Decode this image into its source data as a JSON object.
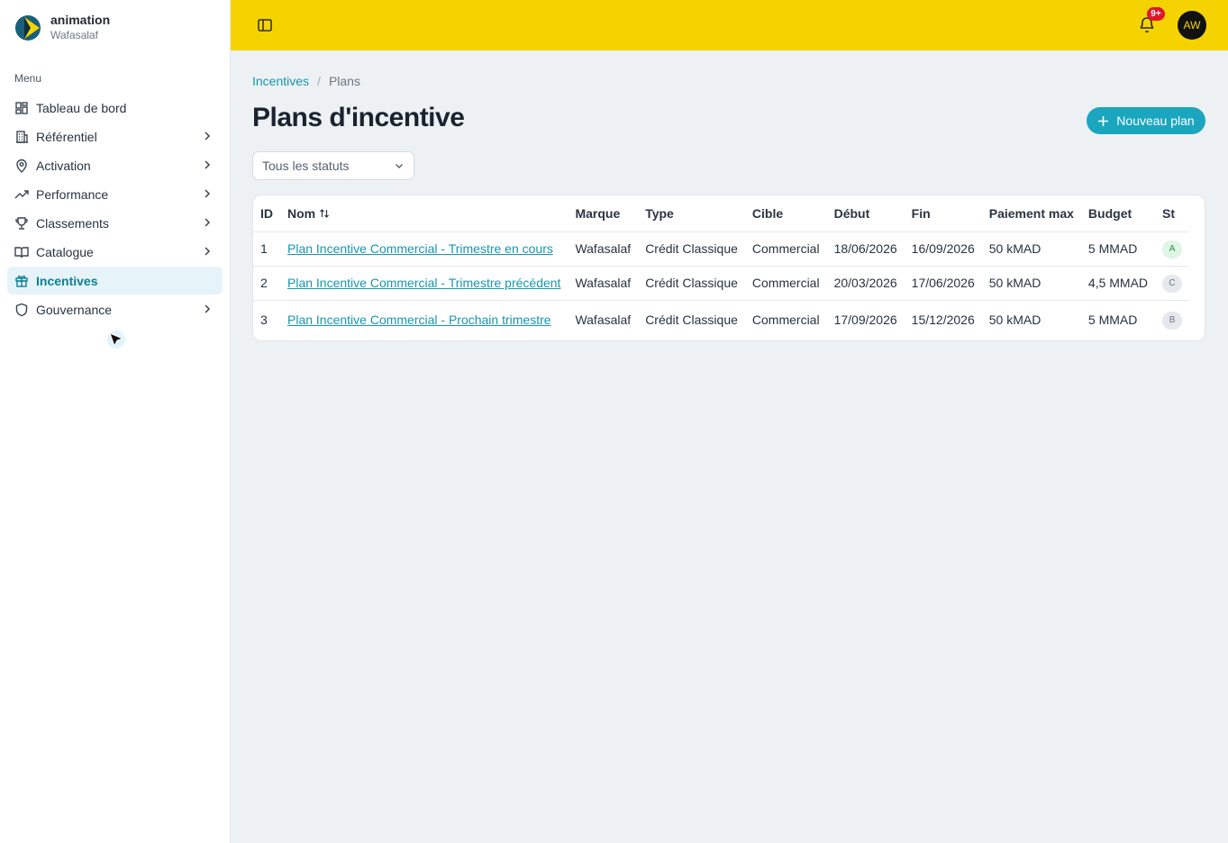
{
  "app": {
    "name": "animation",
    "org": "Wafasalaf"
  },
  "sidebar": {
    "heading": "Menu",
    "items": [
      {
        "label": "Tableau de bord",
        "icon": "dashboard-icon"
      },
      {
        "label": "Référentiel",
        "icon": "building-icon"
      },
      {
        "label": "Activation",
        "icon": "map-pin-icon"
      },
      {
        "label": "Performance",
        "icon": "trending-up-icon"
      },
      {
        "label": "Classements",
        "icon": "trophy-icon"
      },
      {
        "label": "Catalogue",
        "icon": "book-open-icon"
      },
      {
        "label": "Incentives",
        "icon": "gift-icon",
        "active": true
      },
      {
        "label": "Gouvernance",
        "icon": "shield-icon"
      }
    ]
  },
  "topbar": {
    "notifications_badge": "9+",
    "avatar_initials": "AW",
    "color": "#f5d300"
  },
  "breadcrumb": {
    "parent": "Incentives",
    "separator": "/",
    "current": "Plans"
  },
  "page": {
    "title": "Plans d'incentive",
    "new_button_label": "Nouveau plan"
  },
  "filter": {
    "status_value": "Tous les statuts"
  },
  "table": {
    "headers": [
      "ID",
      "Nom",
      "Marque",
      "Type",
      "Cible",
      "Début",
      "Fin",
      "Paiement max",
      "Budget",
      "St"
    ],
    "rows": [
      {
        "id": "1",
        "nom": "Plan Incentive Commercial - Trimestre en cours",
        "marque": "Wafasalaf",
        "type": "Crédit Classique",
        "cible": "Commercial",
        "debut": "18/06/2026",
        "fin": "16/09/2026",
        "paiement_max": "50 kMAD",
        "budget": "5 MMAD",
        "statut": "A"
      },
      {
        "id": "2",
        "nom": "Plan Incentive Commercial - Trimestre précédent",
        "marque": "Wafasalaf",
        "type": "Crédit Classique",
        "cible": "Commercial",
        "debut": "20/03/2026",
        "fin": "17/06/2026",
        "paiement_max": "50 kMAD",
        "budget": "4,5 MMAD",
        "statut": "C"
      },
      {
        "id": "3",
        "nom": "Plan Incentive Commercial - Prochain trimestre",
        "marque": "Wafasalaf",
        "type": "Crédit Classique",
        "cible": "Commercial",
        "debut": "17/09/2026",
        "fin": "15/12/2026",
        "paiement_max": "50 kMAD",
        "budget": "5 MMAD",
        "statut": "B"
      }
    ]
  },
  "colors": {
    "accent": "#1aa6be",
    "link": "#1796b0",
    "active_bg": "#e6f4f9",
    "badge": "#e0172b"
  }
}
